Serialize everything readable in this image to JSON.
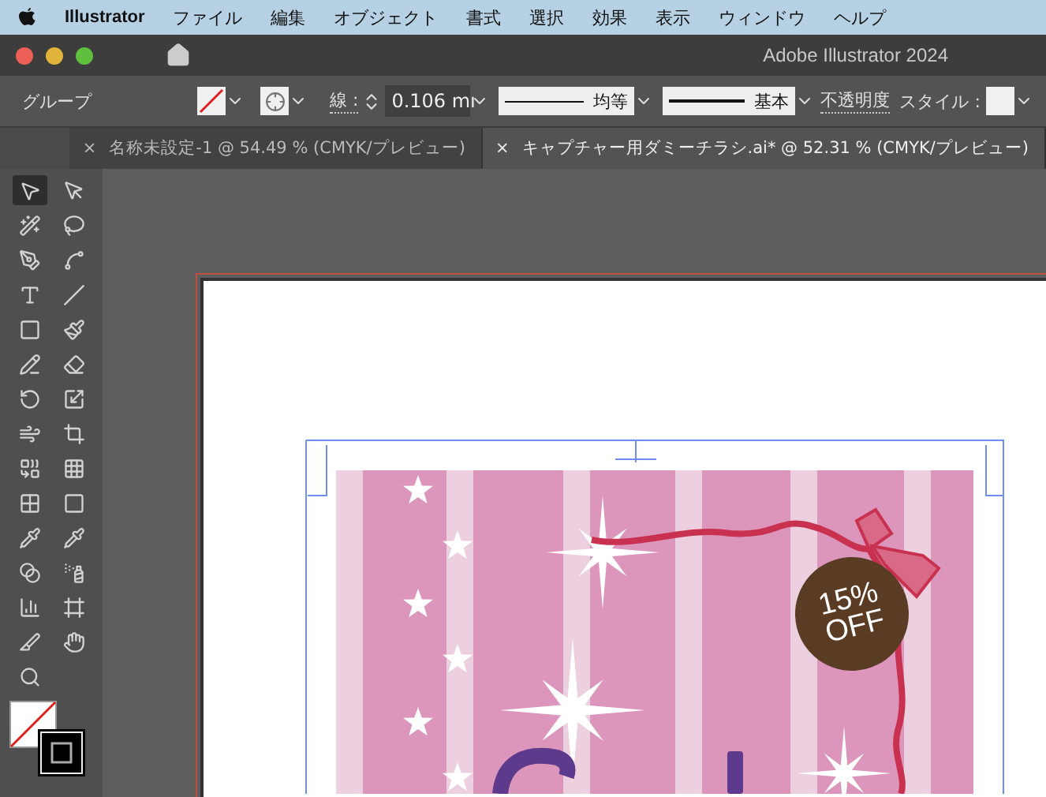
{
  "menu_bar": {
    "items": [
      {
        "label": "Illustrator",
        "kind": "app"
      },
      {
        "label": "ファイル",
        "kind": "menu"
      },
      {
        "label": "編集",
        "kind": "menu"
      },
      {
        "label": "オブジェクト",
        "kind": "menu"
      },
      {
        "label": "書式",
        "kind": "menu"
      },
      {
        "label": "選択",
        "kind": "menu"
      },
      {
        "label": "効果",
        "kind": "menu"
      },
      {
        "label": "表示",
        "kind": "menu"
      },
      {
        "label": "ウィンドウ",
        "kind": "menu"
      },
      {
        "label": "ヘルプ",
        "kind": "menu"
      }
    ]
  },
  "window": {
    "title": "Adobe Illustrator 2024"
  },
  "control_bar": {
    "selection_label": "グループ",
    "stroke_label": "線 :",
    "stroke_weight": "0.106 mı",
    "variable_width": "均等",
    "brush": "基本",
    "opacity_label": "不透明度",
    "style_label": "スタイル :"
  },
  "tabs": [
    {
      "label": "名称未設定-1 @ 54.49 % (CMYK/プレビュー)",
      "close": "×",
      "selected": false
    },
    {
      "label": "キャプチャー用ダミーチラシ.ai* @ 52.31 % (CMYK/プレビュー)",
      "close": "×",
      "selected": true
    }
  ],
  "tools": [
    {
      "kind": "selection",
      "selected": true
    },
    {
      "kind": "direct-selection",
      "selected": false
    },
    {
      "kind": "magic-wand",
      "selected": false
    },
    {
      "kind": "lasso",
      "selected": false
    },
    {
      "kind": "pen",
      "selected": false
    },
    {
      "kind": "curvature",
      "selected": false
    },
    {
      "kind": "type",
      "selected": false
    },
    {
      "kind": "line",
      "selected": false
    },
    {
      "kind": "rectangle",
      "selected": false
    },
    {
      "kind": "paintbrush",
      "selected": false
    },
    {
      "kind": "shaper",
      "selected": false
    },
    {
      "kind": "eraser",
      "selected": false
    },
    {
      "kind": "rotate",
      "selected": false
    },
    {
      "kind": "scale",
      "selected": false
    },
    {
      "kind": "warp",
      "selected": false
    },
    {
      "kind": "free-transform",
      "selected": false
    },
    {
      "kind": "shape-builder",
      "selected": false
    },
    {
      "kind": "perspective",
      "selected": false
    },
    {
      "kind": "mesh",
      "selected": false
    },
    {
      "kind": "gradient",
      "selected": false
    },
    {
      "kind": "eyedropper",
      "selected": false
    },
    {
      "kind": "dropper",
      "selected": false
    },
    {
      "kind": "blend",
      "selected": false
    },
    {
      "kind": "symbol-sprayer",
      "selected": false
    },
    {
      "kind": "graph",
      "selected": false
    },
    {
      "kind": "artboard",
      "selected": false
    },
    {
      "kind": "slice",
      "selected": false
    },
    {
      "kind": "hand",
      "selected": false
    },
    {
      "kind": "zoom",
      "selected": false
    }
  ],
  "artwork": {
    "badge": {
      "line_1": "15%",
      "line_2": "OFF"
    }
  }
}
